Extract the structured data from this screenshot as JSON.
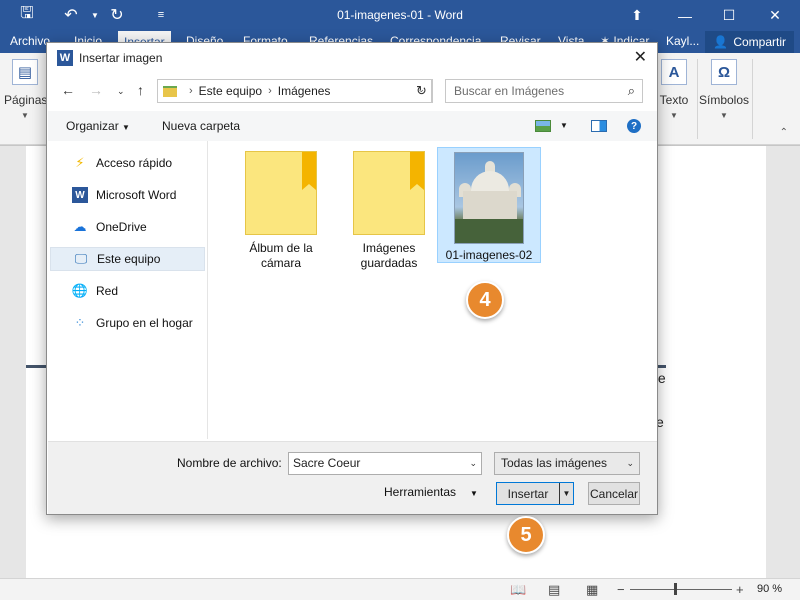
{
  "window": {
    "title": "01-imagenes-01  -  Word",
    "tabs": [
      "Archivo",
      "Inicio",
      "Insertar",
      "Diseño",
      "Formato",
      "Referencias",
      "Correspondencia",
      "Revisar",
      "Vista"
    ],
    "active_tab": "Insertar",
    "tell_me": "Indicar",
    "user": "Kayl...",
    "share_label": "Compartir"
  },
  "ribbon": {
    "groups": [
      {
        "label": "Páginas",
        "icon": "page-icon"
      },
      {
        "label": "Texto",
        "icon": "text-icon"
      },
      {
        "label": "Símbolos",
        "icon": "omega-icon"
      }
    ]
  },
  "document": {
    "fragments": [
      "te",
      "e"
    ]
  },
  "dialog": {
    "title": "Insertar imagen",
    "breadcrumb": [
      "Este equipo",
      "Imágenes"
    ],
    "search_placeholder": "Buscar en Imágenes",
    "organize_label": "Organizar",
    "new_folder_label": "Nueva carpeta",
    "nav_items": [
      {
        "label": "Acceso rápido",
        "icon": "star-icon"
      },
      {
        "label": "Microsoft Word",
        "icon": "word-icon"
      },
      {
        "label": "OneDrive",
        "icon": "cloud-icon"
      },
      {
        "label": "Este equipo",
        "icon": "computer-icon"
      },
      {
        "label": "Red",
        "icon": "network-icon"
      },
      {
        "label": "Grupo en el hogar",
        "icon": "homegroup-icon"
      }
    ],
    "selected_nav": "Este equipo",
    "files": [
      {
        "label": "Álbum de la cámara",
        "type": "folder"
      },
      {
        "label": "Imágenes guardadas",
        "type": "folder"
      },
      {
        "label": "01-imagenes-02",
        "type": "image"
      }
    ],
    "selected_file": "01-imagenes-02",
    "filename_label": "Nombre de archivo:",
    "filename_value": "Sacre Coeur",
    "filetype_value": "Todas las imágenes",
    "tools_label": "Herramientas",
    "insert_label": "Insertar",
    "cancel_label": "Cancelar"
  },
  "callouts": [
    "4",
    "5"
  ],
  "status": {
    "zoom": "90 %"
  },
  "colors": {
    "word_blue": "#2b579a",
    "callout_orange": "#e8892e",
    "selection": "#cce8ff"
  }
}
